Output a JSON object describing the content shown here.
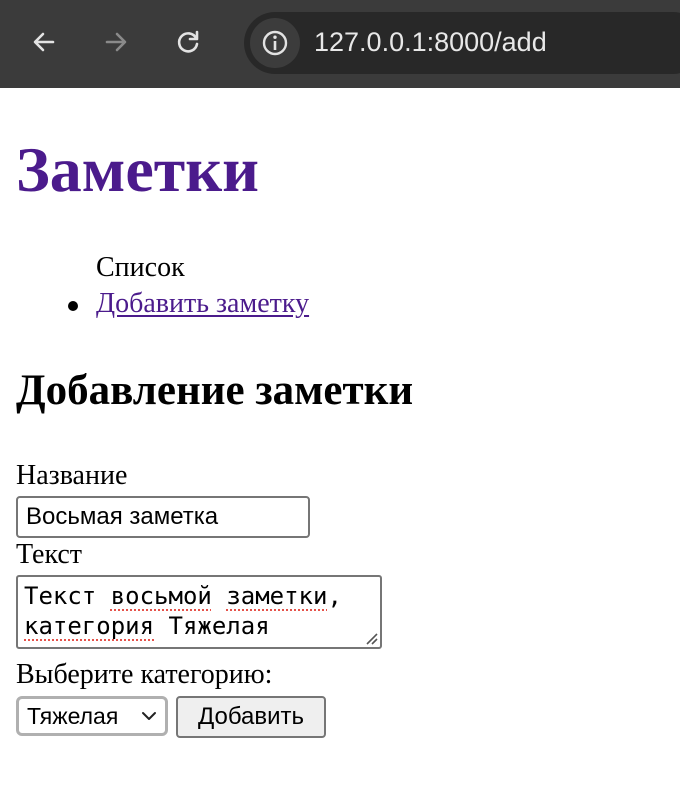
{
  "browser": {
    "url": "127.0.0.1:8000/add",
    "icons": [
      "arrow-left-icon",
      "arrow-right-icon",
      "reload-icon",
      "info-icon"
    ]
  },
  "header": {
    "title": "Заметки"
  },
  "nav": {
    "items": [
      {
        "label": "Список",
        "link": false
      },
      {
        "label": "Добавить заметку",
        "link": true
      }
    ]
  },
  "form": {
    "heading": "Добавление заметки",
    "title_label": "Название",
    "title_value": "Восьмая заметка",
    "text_label": "Текст",
    "text_line1_a": "Текст ",
    "text_line1_b": "восьмой",
    "text_line1_c": " ",
    "text_line1_d": "заметки",
    "text_line1_e": ",",
    "text_line2_a": "категория",
    "text_line2_b": " Тяжелая",
    "category_label": "Выберите категорию:",
    "category_selected": "Тяжелая",
    "submit_label": "Добавить"
  },
  "colors": {
    "link": "#4b1b8c",
    "toolbar": "#3b3b3b",
    "omnibox": "#282828"
  }
}
